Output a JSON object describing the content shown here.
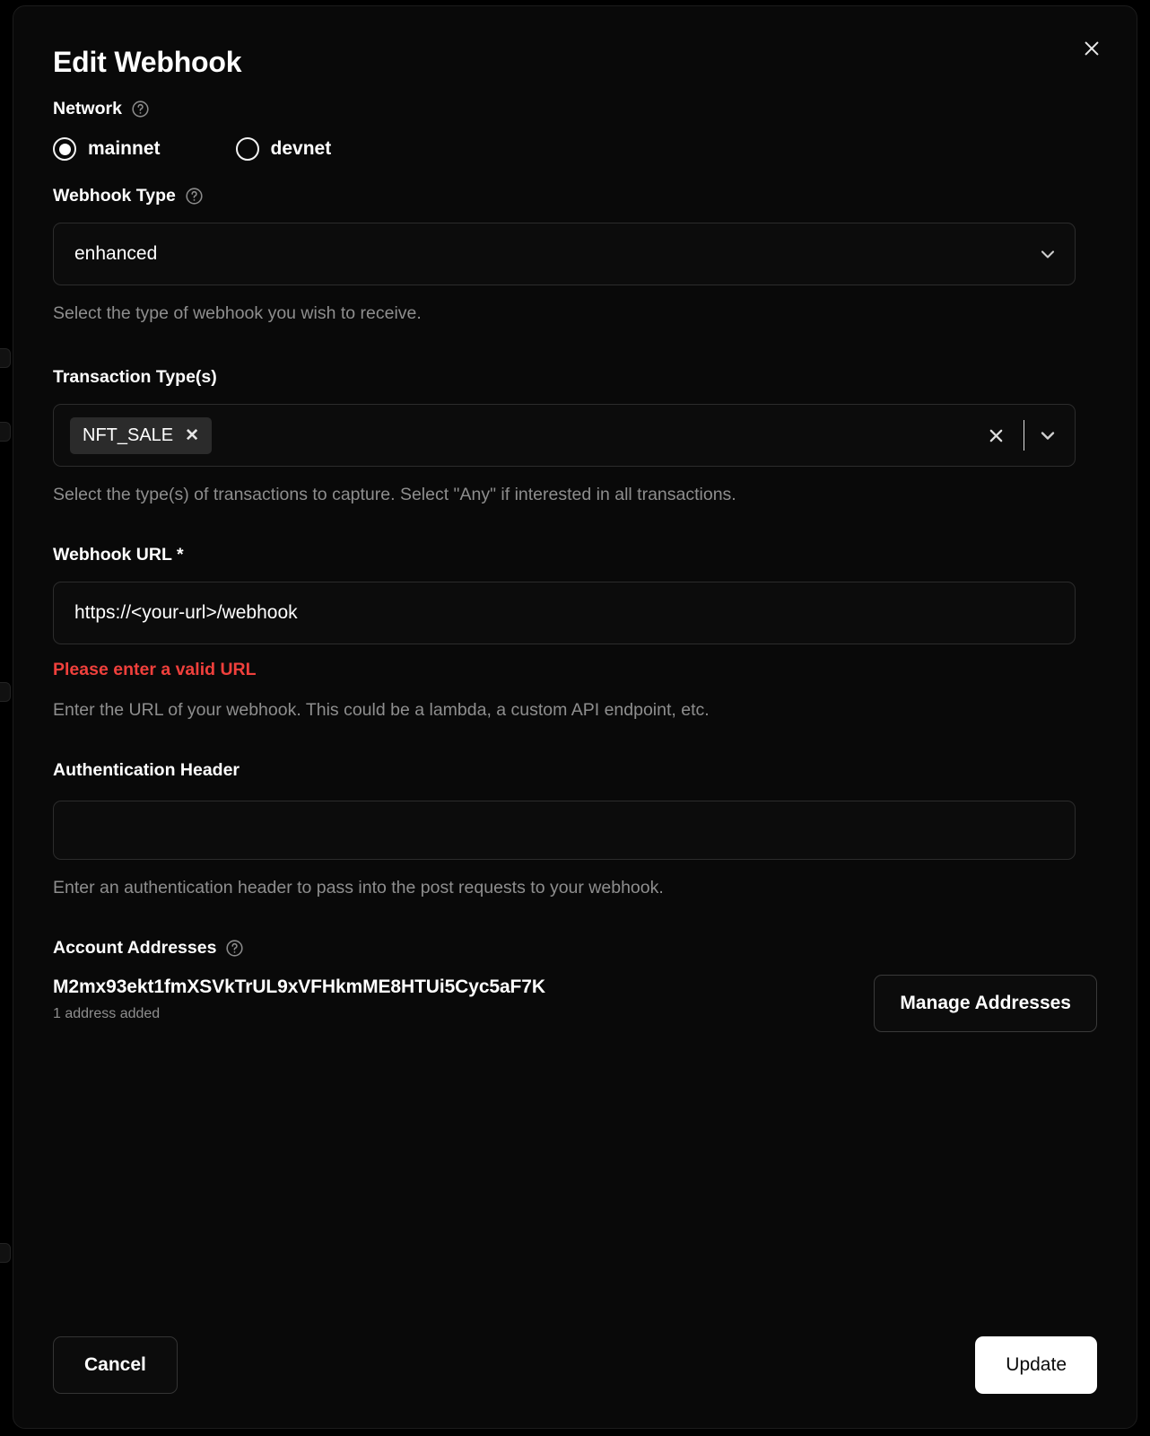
{
  "modal": {
    "title": "Edit Webhook",
    "close_icon": "close-icon"
  },
  "network": {
    "label": "Network",
    "help_icon": "help-circle-icon",
    "options": [
      {
        "label": "mainnet",
        "selected": true
      },
      {
        "label": "devnet",
        "selected": false
      }
    ]
  },
  "webhook_type": {
    "label": "Webhook Type",
    "help_icon": "help-circle-icon",
    "value": "enhanced",
    "chevron_icon": "chevron-down-icon",
    "helper": "Select the type of webhook you wish to receive."
  },
  "transaction_types": {
    "label": "Transaction Type(s)",
    "chips": [
      {
        "label": "NFT_SALE",
        "remove_icon": "close-icon"
      }
    ],
    "clear_icon": "close-icon",
    "chevron_icon": "chevron-down-icon",
    "helper": "Select the type(s) of transactions to capture. Select \"Any\" if interested in all transactions."
  },
  "webhook_url": {
    "label": "Webhook URL *",
    "value": "https://<your-url>/webhook",
    "placeholder": "https://<your-url>/webhook",
    "error": "Please enter a valid URL",
    "helper": "Enter the URL of your webhook. This could be a lambda, a custom API endpoint, etc."
  },
  "auth_header": {
    "label": "Authentication Header",
    "value": "",
    "placeholder": "",
    "helper": "Enter an authentication header to pass into the post requests to your webhook."
  },
  "account_addresses": {
    "label": "Account Addresses",
    "help_icon": "help-circle-icon",
    "address": "M2mx93ekt1fmXSVkTrUL9xVFHkmME8HTUi5Cyc5aF7K",
    "count_text": "1 address added",
    "manage_button": "Manage Addresses"
  },
  "footer": {
    "cancel_label": "Cancel",
    "submit_label": "Update"
  },
  "colors": {
    "background": "#000000",
    "modal_background": "#090909",
    "accent_white": "#ffffff",
    "error_red": "#f0403c",
    "muted_text": "#8e8e8e",
    "chip_background": "#2b2b2b",
    "border": "#2c2c2c"
  }
}
